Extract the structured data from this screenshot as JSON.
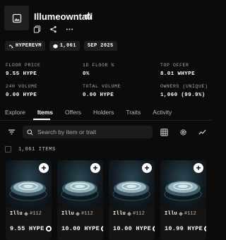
{
  "collection": {
    "name": "Illumeowntati",
    "icon": "image-icon",
    "chips": [
      {
        "icon": "link-icon",
        "label": "HYPEREVM"
      },
      {
        "icon": "cube-icon",
        "label": "1,061"
      },
      {
        "icon": "none",
        "label": "SEP 2025"
      }
    ]
  },
  "stats": [
    {
      "label": "FLOOR PRICE",
      "value": "9.55 HYPE"
    },
    {
      "label": "1D FLOOR %",
      "value": "0%"
    },
    {
      "label": "TOP OFFER",
      "value": "8.01 WHYPE"
    },
    {
      "label": "24H VOLUME",
      "value": "0.00 HYPE"
    },
    {
      "label": "TOTAL VOLUME",
      "value": "0.00 HYPE"
    },
    {
      "label": "OWNERS (UNIQUE)",
      "value": "1,060 (99.9%)"
    }
  ],
  "tabs": [
    "Explore",
    "Items",
    "Offers",
    "Holders",
    "Traits",
    "Activity"
  ],
  "active_tab": "Items",
  "search": {
    "placeholder": "Search by item or trait"
  },
  "items_count": "1,061 ITEMS",
  "cards": [
    {
      "name": "Illu",
      "token": "#112",
      "price": "9.55 HYPE"
    },
    {
      "name": "Illu",
      "token": "#112",
      "price": "10.00 HYPE"
    },
    {
      "name": "Illu",
      "token": "#112",
      "price": "10.00 HYPE"
    },
    {
      "name": "Illu",
      "token": "#112",
      "price": "10.99 HYPE"
    }
  ],
  "colors": {
    "background": "#0b0b0b",
    "surface": "#1c1c1c",
    "text": "#ffffff",
    "muted": "#a9a9a9"
  }
}
